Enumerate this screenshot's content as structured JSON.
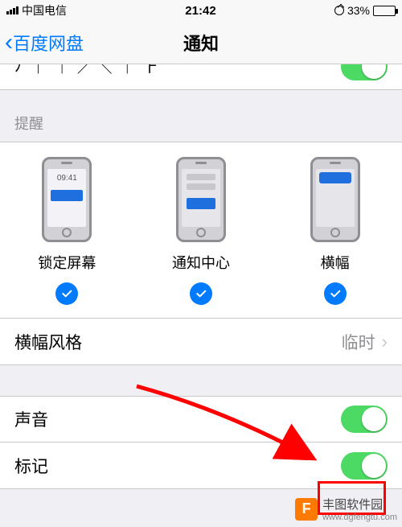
{
  "status": {
    "carrier": "中国电信",
    "time": "21:42",
    "battery_pct": "33%"
  },
  "nav": {
    "back_label": "百度网盘",
    "title": "通知"
  },
  "cut_row": {
    "partial_text": "ﾉ  ｜  ｜  ╱╲  ｜  ⺊"
  },
  "alerts": {
    "section_header": "提醒",
    "lock_time": "09:41",
    "options": [
      {
        "label": "锁定屏幕"
      },
      {
        "label": "通知中心"
      },
      {
        "label": "横幅"
      }
    ]
  },
  "banner_style": {
    "label": "横幅风格",
    "value": "临时"
  },
  "sounds": {
    "label": "声音"
  },
  "badges": {
    "label": "标记"
  },
  "watermark": {
    "logo_text": "F",
    "name": "丰图软件园",
    "url": "www.dgfengtu.com"
  }
}
